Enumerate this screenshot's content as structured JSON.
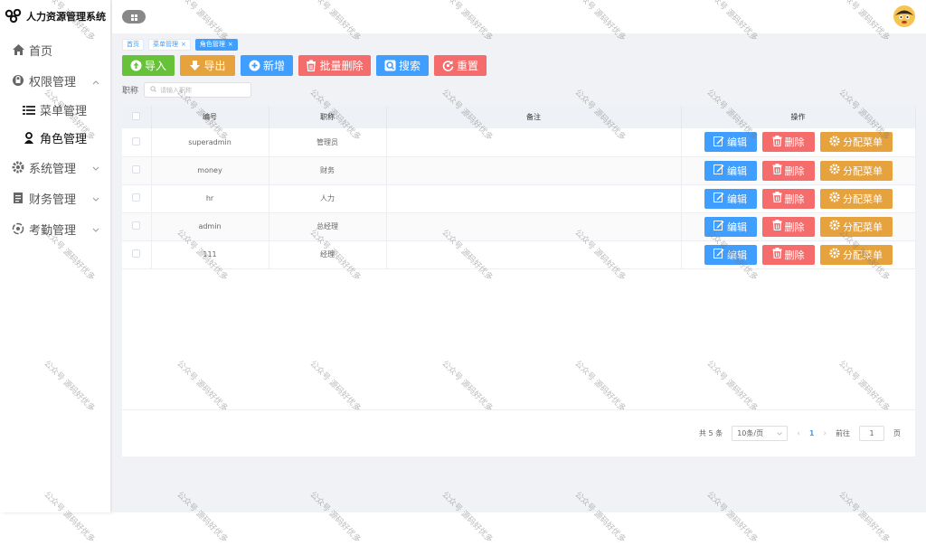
{
  "app": {
    "title": "人力资源管理系统"
  },
  "sidebar": {
    "items": [
      {
        "label": "首页",
        "icon": "home-icon"
      },
      {
        "label": "权限管理",
        "icon": "shield-icon"
      },
      {
        "label": "菜单管理",
        "icon": "list-icon"
      },
      {
        "label": "角色管理",
        "icon": "user-icon"
      },
      {
        "label": "系统管理",
        "icon": "gear-icon"
      },
      {
        "label": "财务管理",
        "icon": "document-icon"
      },
      {
        "label": "考勤管理",
        "icon": "clock-icon"
      }
    ]
  },
  "tags": [
    {
      "label": "首页"
    },
    {
      "label": "菜单管理",
      "close": "×"
    },
    {
      "label": "角色管理",
      "close": "×"
    }
  ],
  "toolbar": {
    "import_label": "导入",
    "export_label": "导出",
    "add_label": "新增",
    "batch_delete_label": "批量删除",
    "search_label": "搜索",
    "reset_label": "重置"
  },
  "search": {
    "label": "职称",
    "placeholder": "请输入职称"
  },
  "table": {
    "headers": [
      "编号",
      "职称",
      "备注",
      "操作"
    ],
    "rows": [
      {
        "code": "superadmin",
        "title": "管理员",
        "note": ""
      },
      {
        "code": "money",
        "title": "财务",
        "note": ""
      },
      {
        "code": "hr",
        "title": "人力",
        "note": ""
      },
      {
        "code": "admin",
        "title": "总经理",
        "note": ""
      },
      {
        "code": "111",
        "title": "经理",
        "note": ""
      }
    ],
    "action_edit": "编辑",
    "action_delete": "删除",
    "action_assign": "分配菜单"
  },
  "pagination": {
    "total_label": "共 5 条",
    "page_size": "10条/页",
    "prev": "‹",
    "next": "›",
    "current_page": "1",
    "goto_label": "前往",
    "goto_value": "1",
    "page_unit": "页"
  },
  "watermark": {
    "text": "公众号 源码好优多"
  },
  "colors": {
    "primary": "#409eff",
    "success": "#67c23a",
    "warning": "#e6a23c",
    "danger": "#f56c6c"
  }
}
